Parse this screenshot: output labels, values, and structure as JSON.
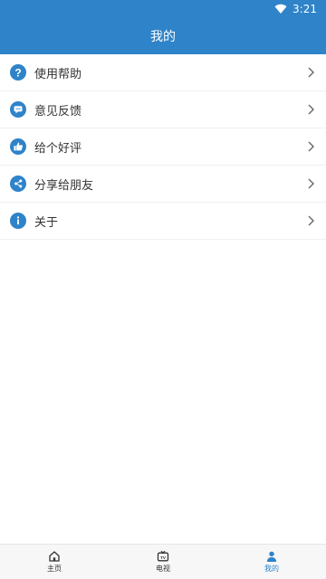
{
  "status_bar": {
    "time": "3:21"
  },
  "header": {
    "title": "我的"
  },
  "menu": [
    {
      "label": "使用帮助",
      "icon": "help-icon"
    },
    {
      "label": "意见反馈",
      "icon": "feedback-icon"
    },
    {
      "label": "给个好评",
      "icon": "thumbs-up-icon"
    },
    {
      "label": "分享给朋友",
      "icon": "share-icon"
    },
    {
      "label": "关于",
      "icon": "info-icon"
    }
  ],
  "bottom_nav": [
    {
      "label": "主页",
      "icon": "home-icon",
      "active": false
    },
    {
      "label": "电视",
      "icon": "tv-icon",
      "active": false
    },
    {
      "label": "我的",
      "icon": "user-icon",
      "active": true
    }
  ],
  "colors": {
    "accent": "#2f83c9"
  }
}
